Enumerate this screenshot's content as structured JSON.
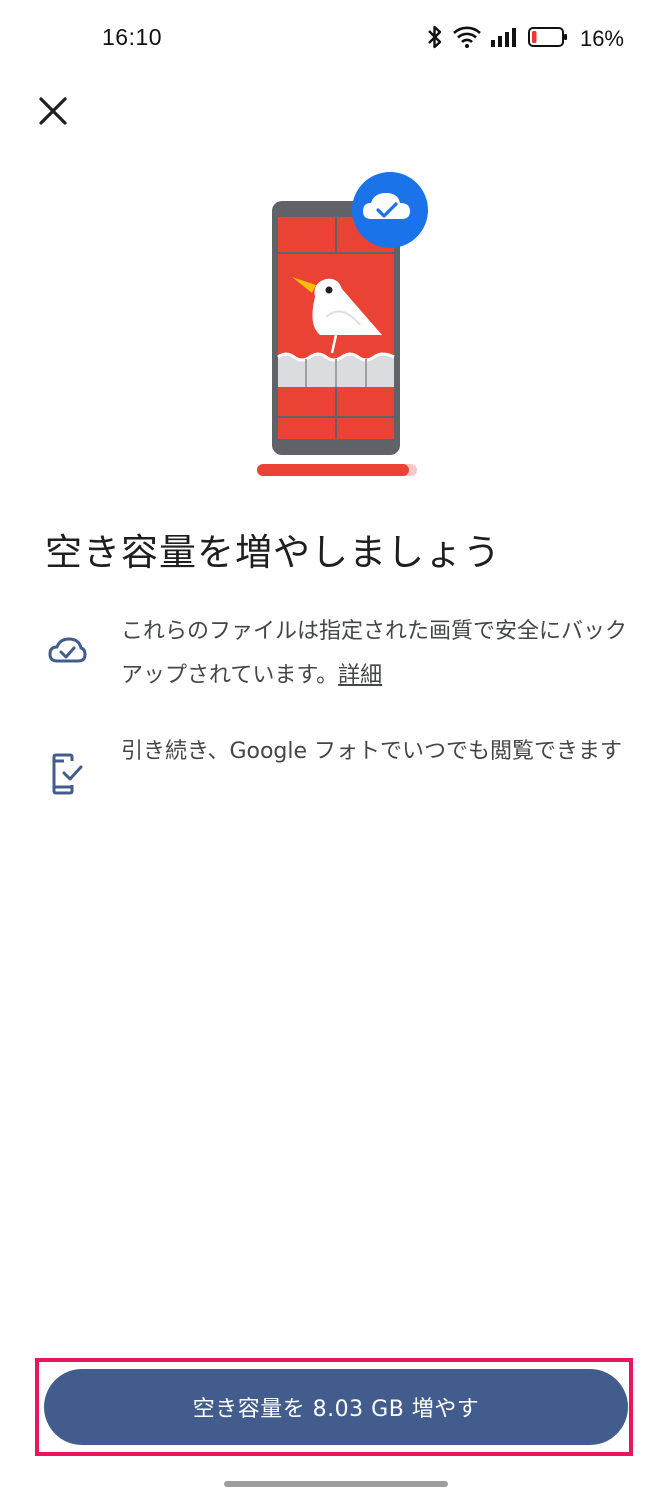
{
  "status_bar": {
    "time": "16:10",
    "battery_percent": "16%",
    "battery_level": 0.16,
    "icons": [
      "bluetooth-icon",
      "wifi-icon",
      "signal-icon",
      "battery-icon"
    ]
  },
  "header": {
    "close_icon": "close-icon"
  },
  "main": {
    "title": "空き容量を増やしましょう",
    "info_items": [
      {
        "icon": "cloud-check-icon",
        "text": "これらのファイルは指定された画質で安全にバックアップされています。",
        "link": "詳細"
      },
      {
        "icon": "phone-check-icon",
        "text": "引き続き、Google フォトでいつでも閲覧できます"
      }
    ]
  },
  "footer": {
    "primary_button_label": "空き容量を 8.03 GB 増やす"
  },
  "colors": {
    "accent": "#425d8d",
    "brand_red": "#ea4335",
    "brand_blue": "#1a73e8",
    "highlight": "#e8175d",
    "icon_blue": "#425d8d"
  }
}
